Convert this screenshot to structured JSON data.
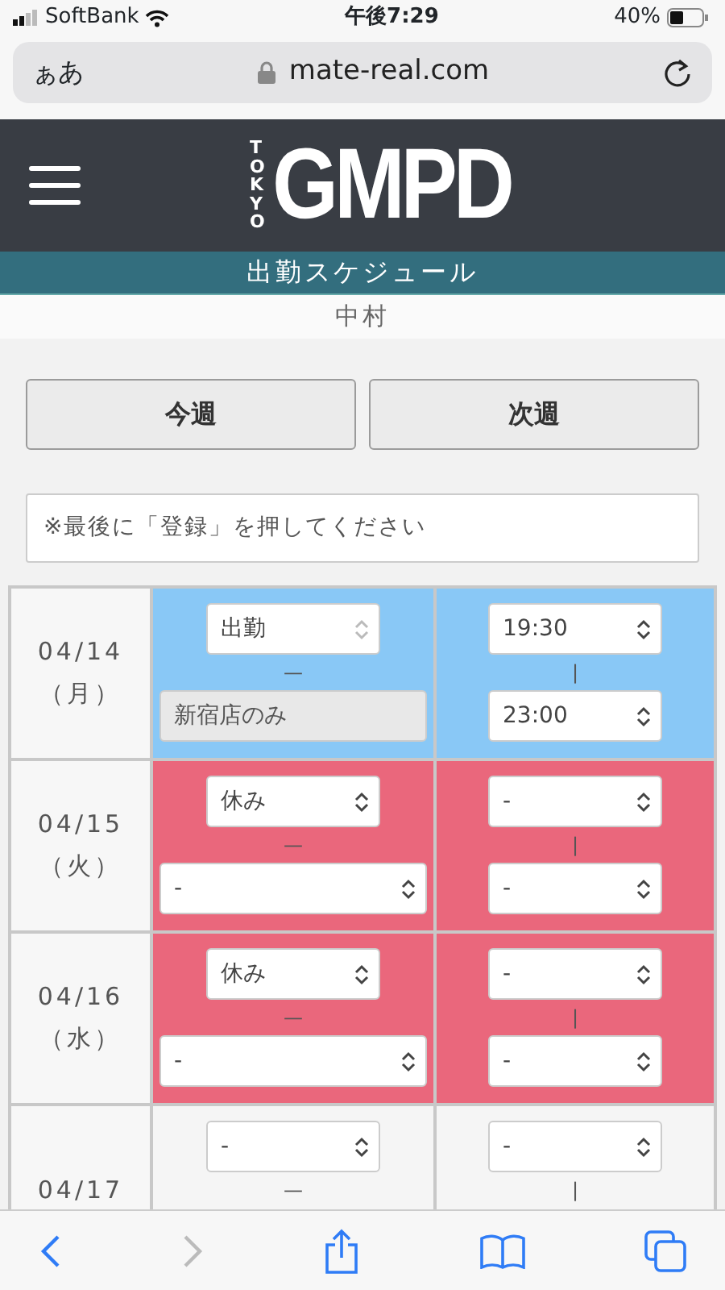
{
  "status_bar": {
    "carrier": "SoftBank",
    "time": "午後7:29",
    "battery": "40%"
  },
  "address_bar": {
    "text_size": "ぁあ",
    "url": "mate-real.com"
  },
  "header": {
    "logo_small": "TOKYO",
    "logo": "GMPD"
  },
  "title": "出勤スケジュール",
  "name": "中村",
  "week_buttons": [
    {
      "label": "今週"
    },
    {
      "label": "次週"
    }
  ],
  "note": "※最後に「登録」を押してください",
  "days": [
    {
      "date": "04/14",
      "weekday": "（月）",
      "kind": "work",
      "status": "出勤",
      "shop": "新宿店のみ",
      "shop_disabled": true,
      "start": "19:30",
      "end": "23:00",
      "dash": "—",
      "bar": "|"
    },
    {
      "date": "04/15",
      "weekday": "（火）",
      "kind": "off",
      "status": "休み",
      "shop": "-",
      "shop_disabled": false,
      "start": "-",
      "end": "-",
      "dash": "—",
      "bar": "|"
    },
    {
      "date": "04/16",
      "weekday": "（水）",
      "kind": "off",
      "status": "休み",
      "shop": "-",
      "shop_disabled": false,
      "start": "-",
      "end": "-",
      "dash": "—",
      "bar": "|"
    },
    {
      "date": "04/17",
      "kind": "blank",
      "status": "-",
      "start": "-",
      "dash": "—",
      "bar": "|"
    }
  ]
}
